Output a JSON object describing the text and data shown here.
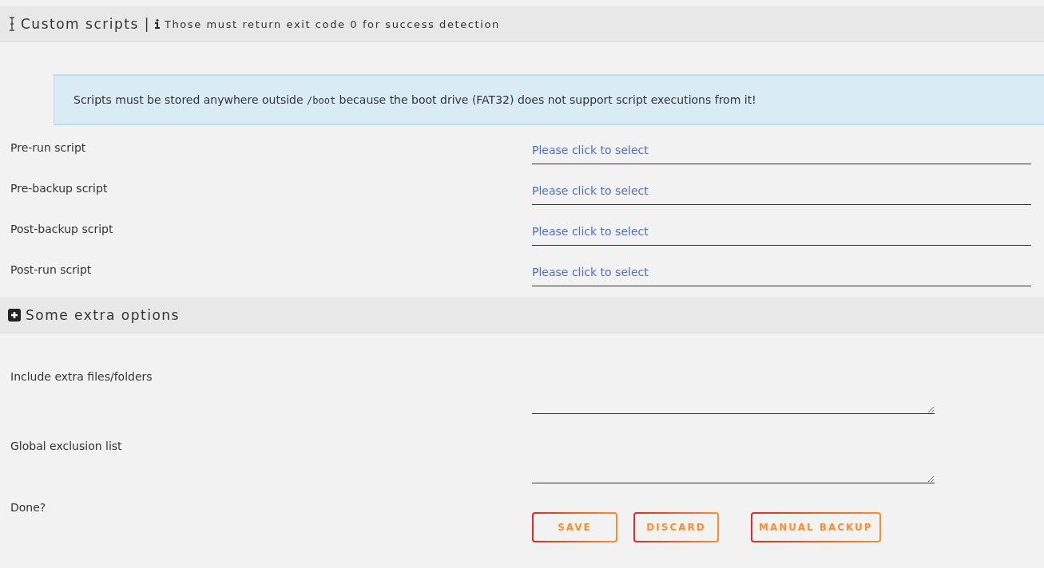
{
  "scripts_section": {
    "title": "Custom scripts |",
    "hint": "Those must return exit code 0 for success detection"
  },
  "notice": {
    "segments": [
      {
        "kind": "text",
        "text": "Scripts must be stored anywhere outside "
      },
      {
        "kind": "code",
        "text": "/boot"
      },
      {
        "kind": "text",
        "text": " because the boot drive (FAT32) does not support script executions from it!"
      }
    ]
  },
  "script_fields": [
    {
      "label": "Pre-run script",
      "placeholder": "Please click to select"
    },
    {
      "label": "Pre-backup script",
      "placeholder": "Please click to select"
    },
    {
      "label": "Post-backup script",
      "placeholder": "Please click to select"
    },
    {
      "label": "Post-run script",
      "placeholder": "Please click to select"
    }
  ],
  "extra_section": {
    "title": "Some extra options",
    "expanded": false
  },
  "extra_fields": [
    {
      "label": "Include extra files/folders"
    },
    {
      "label": "Global exclusion list"
    }
  ],
  "done": {
    "label": "Done?",
    "buttons": [
      "SAVE",
      "DISCARD",
      "MANUAL BACKUP"
    ]
  }
}
